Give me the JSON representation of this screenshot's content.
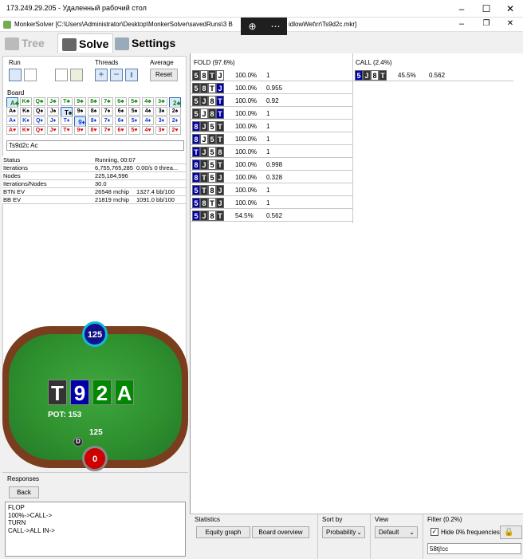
{
  "rdp": {
    "title": "173.249.29.205 - Удаленный рабочий стол"
  },
  "app": {
    "title": "MonkerSolver [C:\\Users\\Administrator\\Desktop\\MonkerSolver\\savedRuns\\3 B",
    "title_tail": "idlowWet\\rr\\Ts9d2c.mkr]"
  },
  "tabs": [
    {
      "label": "Tree"
    },
    {
      "label": "Solve"
    },
    {
      "label": "Settings"
    }
  ],
  "run": {
    "label": "Run",
    "threads_label": "Threads",
    "average_label": "Average",
    "reset_label": "Reset"
  },
  "board": {
    "label": "Board",
    "text": "Ts9d2c Ac",
    "rows": [
      [
        "A♣",
        "K♣",
        "Q♣",
        "J♣",
        "T♣",
        "9♣",
        "8♣",
        "7♣",
        "6♣",
        "5♣",
        "4♣",
        "3♣",
        "2♣"
      ],
      [
        "A♠",
        "K♠",
        "Q♠",
        "J♠",
        "T♠",
        "9♠",
        "8♠",
        "7♠",
        "6♠",
        "5♠",
        "4♠",
        "3♠",
        "2♠"
      ],
      [
        "A♦",
        "K♦",
        "Q♦",
        "J♦",
        "T♦",
        "9♦",
        "8♦",
        "7♦",
        "6♦",
        "5♦",
        "4♦",
        "3♦",
        "2♦"
      ],
      [
        "A♥",
        "K♥",
        "Q♥",
        "J♥",
        "T♥",
        "9♥",
        "8♥",
        "7♥",
        "6♥",
        "5♥",
        "4♥",
        "3♥",
        "2♥"
      ]
    ],
    "row_colors": [
      "#0a8a0a",
      "#000000",
      "#1040d0",
      "#d01010"
    ]
  },
  "stats": [
    {
      "k": "Status",
      "v1": "Running, 00:07",
      "v2": ""
    },
    {
      "k": "Iterations",
      "v1": "6,755,765,285",
      "v2": "0.00/s 0 threa..."
    },
    {
      "k": "Nodes",
      "v1": "225,184,596",
      "v2": ""
    },
    {
      "k": "Iterations/Nodes",
      "v1": "30.0",
      "v2": ""
    },
    {
      "k": "BTN EV",
      "v1": "26548 mchip",
      "v2": "1327.4 bb/100"
    },
    {
      "k": "BB EV",
      "v1": "21819 mchip",
      "v2": "1091.0 bb/100"
    }
  ],
  "felt": {
    "top_stack": "125",
    "board": [
      "T",
      "9",
      "2",
      "A"
    ],
    "board_colors": [
      "#333333",
      "#0000aa",
      "#008800",
      "#008800"
    ],
    "pot": "POT: 153",
    "hero_stack": "125",
    "dealer": "D",
    "hero_chip": "0"
  },
  "responses": {
    "label": "Responses",
    "back_label": "Back",
    "lines": [
      "FLOP",
      "100%->CALL->",
      "TURN",
      "CALL->ALL IN->"
    ]
  },
  "fold": {
    "header": "FOLD (97.6%)",
    "rows": [
      {
        "c": [
          [
            "5",
            "s"
          ],
          [
            "8",
            "h"
          ],
          [
            "T",
            "s"
          ],
          [
            "J",
            "h"
          ]
        ],
        "p": "100.0%",
        "e": "1"
      },
      {
        "c": [
          [
            "5",
            "s"
          ],
          [
            "8",
            "s"
          ],
          [
            "T",
            "h"
          ],
          [
            "J",
            "d"
          ]
        ],
        "p": "100.0%",
        "e": "0.955"
      },
      {
        "c": [
          [
            "5",
            "s"
          ],
          [
            "J",
            "s"
          ],
          [
            "8",
            "h"
          ],
          [
            "T",
            "d"
          ]
        ],
        "p": "100.0%",
        "e": "0.92"
      },
      {
        "c": [
          [
            "5",
            "s"
          ],
          [
            "J",
            "h"
          ],
          [
            "8",
            "s"
          ],
          [
            "T",
            "d"
          ]
        ],
        "p": "100.0%",
        "e": "1"
      },
      {
        "c": [
          [
            "8",
            "d"
          ],
          [
            "J",
            "s"
          ],
          [
            "5",
            "h"
          ],
          [
            "T",
            "s"
          ]
        ],
        "p": "100.0%",
        "e": "1"
      },
      {
        "c": [
          [
            "8",
            "d"
          ],
          [
            "J",
            "h"
          ],
          [
            "5",
            "s"
          ],
          [
            "T",
            "s"
          ]
        ],
        "p": "100.0%",
        "e": "1"
      },
      {
        "c": [
          [
            "T",
            "d"
          ],
          [
            "J",
            "s"
          ],
          [
            "5",
            "h"
          ],
          [
            "8",
            "s"
          ]
        ],
        "p": "100.0%",
        "e": "1"
      },
      {
        "c": [
          [
            "8",
            "d"
          ],
          [
            "J",
            "s"
          ],
          [
            "5",
            "h"
          ],
          [
            "T",
            "s"
          ]
        ],
        "p": "100.0%",
        "e": "0.998"
      },
      {
        "c": [
          [
            "8",
            "d"
          ],
          [
            "T",
            "s"
          ],
          [
            "5",
            "h"
          ],
          [
            "J",
            "s"
          ]
        ],
        "p": "100.0%",
        "e": "0.328"
      },
      {
        "c": [
          [
            "5",
            "d"
          ],
          [
            "T",
            "s"
          ],
          [
            "8",
            "h"
          ],
          [
            "J",
            "s"
          ]
        ],
        "p": "100.0%",
        "e": "1"
      },
      {
        "c": [
          [
            "5",
            "d"
          ],
          [
            "8",
            "s"
          ],
          [
            "T",
            "h"
          ],
          [
            "J",
            "s"
          ]
        ],
        "p": "100.0%",
        "e": "1"
      },
      {
        "c": [
          [
            "5",
            "d"
          ],
          [
            "J",
            "s"
          ],
          [
            "8",
            "h"
          ],
          [
            "T",
            "s"
          ]
        ],
        "p": "54.5%",
        "e": "0.562"
      }
    ]
  },
  "call": {
    "header": "CALL (2.4%)",
    "rows": [
      {
        "c": [
          [
            "5",
            "d"
          ],
          [
            "J",
            "s"
          ],
          [
            "8",
            "h"
          ],
          [
            "T",
            "s"
          ]
        ],
        "p": "45.5%",
        "e": "0.562"
      }
    ]
  },
  "bottom": {
    "statistics": "Statistics",
    "equity_graph": "Equity graph",
    "board_overview": "Board overview",
    "sort_by": "Sort by",
    "sort_value": "Probability",
    "view": "View",
    "view_value": "Default",
    "filter": "Filter (0.2%)",
    "hide_label": "Hide 0% frequencies",
    "filter_text": "58tj!cc"
  }
}
